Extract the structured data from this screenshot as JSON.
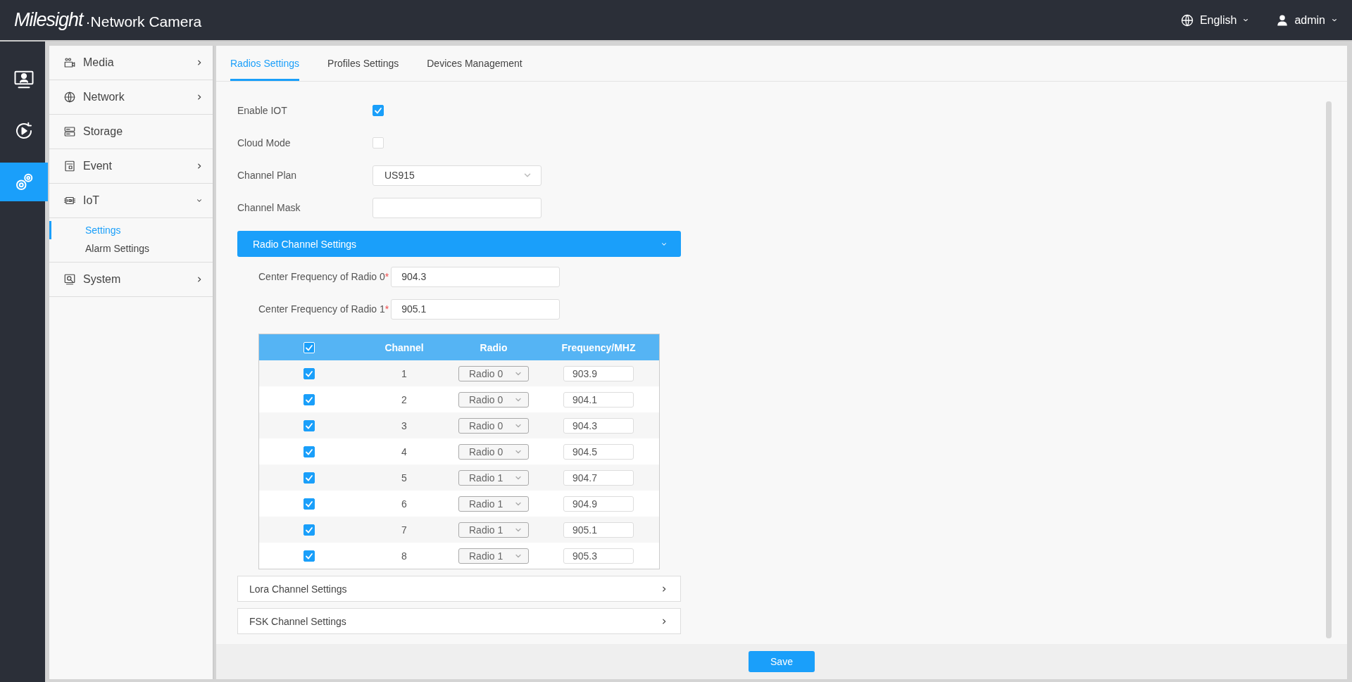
{
  "header": {
    "logo": "Milesight",
    "product": "·Network Camera",
    "language": "English",
    "user": "admin"
  },
  "rail": [
    {
      "kind": "live",
      "selected": false
    },
    {
      "kind": "playback",
      "selected": false
    },
    {
      "kind": "settings",
      "selected": true
    }
  ],
  "sidebar": {
    "items": [
      {
        "label": "Media",
        "kind": "group",
        "expanded": false
      },
      {
        "label": "Network",
        "kind": "group",
        "expanded": false
      },
      {
        "label": "Storage",
        "kind": "link"
      },
      {
        "label": "Event",
        "kind": "group",
        "expanded": false
      },
      {
        "label": "IoT",
        "kind": "group",
        "expanded": true,
        "children": [
          {
            "label": "Settings",
            "selected": true
          },
          {
            "label": "Alarm Settings",
            "selected": false
          }
        ]
      },
      {
        "label": "System",
        "kind": "group",
        "expanded": false
      }
    ]
  },
  "tabs": [
    {
      "label": "Radios Settings",
      "selected": true
    },
    {
      "label": "Profiles Settings",
      "selected": false
    },
    {
      "label": "Devices Management",
      "selected": false
    }
  ],
  "form": [
    {
      "kind": "checkbox",
      "label": "Enable IOT",
      "checked": true
    },
    {
      "kind": "checkbox",
      "label": "Cloud Mode",
      "checked": false
    },
    {
      "kind": "select",
      "label": "Channel Plan",
      "value": "US915"
    },
    {
      "kind": "input",
      "label": "Channel Mask"
    }
  ],
  "radio_section": {
    "title": "Radio Channel Settings",
    "expanded": true,
    "fields": [
      {
        "label": "Center Frequency of Radio 0",
        "required_mark": "*",
        "value": "904.3"
      },
      {
        "label": "Center Frequency of Radio 1",
        "required_mark": "*",
        "value": "905.1"
      }
    ],
    "table": {
      "all_checked": true,
      "columns": [
        "Channel",
        "Radio",
        "Frequency/MHZ"
      ],
      "rows": [
        {
          "checked": true,
          "channel": "1",
          "radio": "Radio 0",
          "frequency": "903.9"
        },
        {
          "checked": true,
          "channel": "2",
          "radio": "Radio 0",
          "frequency": "904.1"
        },
        {
          "checked": true,
          "channel": "3",
          "radio": "Radio 0",
          "frequency": "904.3"
        },
        {
          "checked": true,
          "channel": "4",
          "radio": "Radio 0",
          "frequency": "904.5"
        },
        {
          "checked": true,
          "channel": "5",
          "radio": "Radio 1",
          "frequency": "904.7"
        },
        {
          "checked": true,
          "channel": "6",
          "radio": "Radio 1",
          "frequency": "904.9"
        },
        {
          "checked": true,
          "channel": "7",
          "radio": "Radio 1",
          "frequency": "905.1"
        },
        {
          "checked": true,
          "channel": "8",
          "radio": "Radio 1",
          "frequency": "905.3"
        }
      ]
    }
  },
  "sections": [
    {
      "title": "Lora Channel Settings",
      "expanded": false
    },
    {
      "title": "FSK Channel Settings",
      "expanded": false
    }
  ],
  "save_button": "Save"
}
